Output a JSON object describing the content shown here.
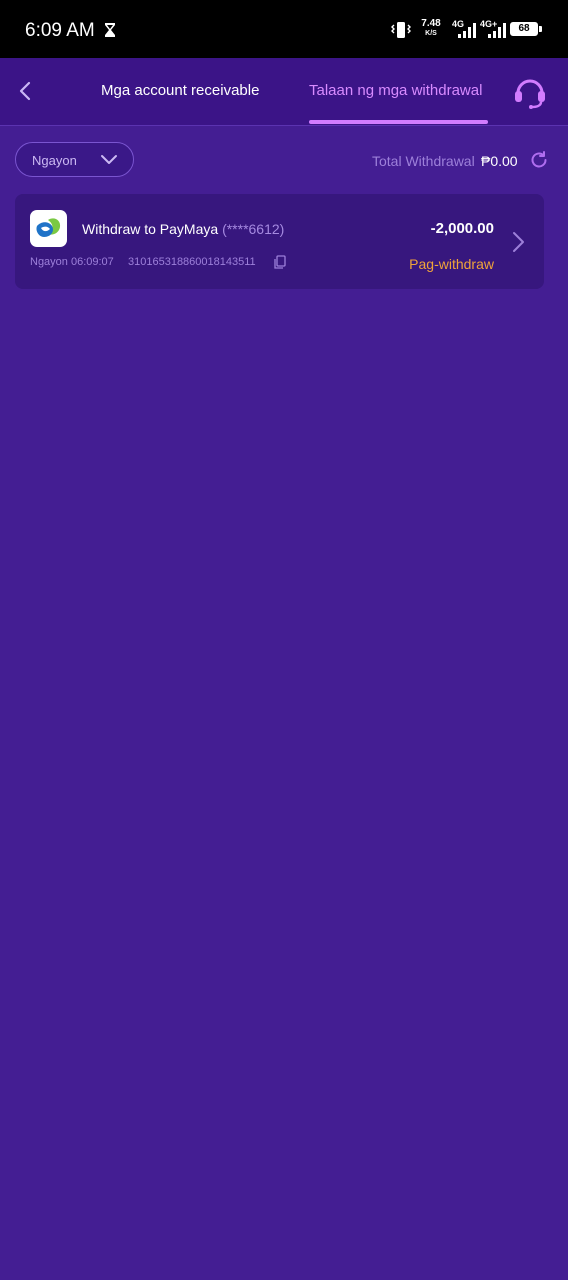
{
  "status_bar": {
    "time": "6:09 AM",
    "speed_value": "7.48",
    "speed_unit": "K/S",
    "sim1_label": "4G",
    "sim2_label": "4G+",
    "battery": "68"
  },
  "header": {
    "back_icon": "chevron-left-icon",
    "tabs": [
      {
        "label": "Mga account receivable",
        "active": false
      },
      {
        "label": "Talaan ng mga withdrawal",
        "active": true
      }
    ],
    "support_icon": "headset-icon"
  },
  "filter": {
    "date_value": "Ngayon",
    "total_label": "Total Withdrawal",
    "total_value": "₱0.00"
  },
  "records": [
    {
      "title": "Withdraw to PayMaya",
      "account_masked": "(****6612)",
      "amount": "-2,000.00",
      "time": "Ngayon 06:09:07",
      "order_id": "31016531886001814351​1",
      "status": "Pag-withdraw"
    }
  ],
  "colors": {
    "background": "#441e93",
    "header": "#3b1487",
    "card": "#37177e",
    "accent": "#d27cff",
    "status_pending": "#f0a43a"
  }
}
